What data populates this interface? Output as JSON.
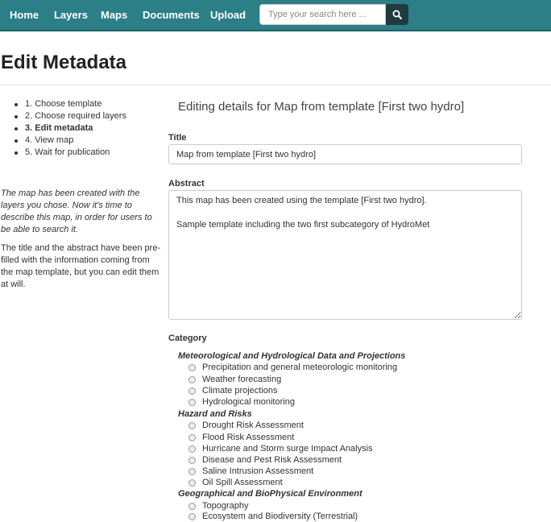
{
  "navbar": {
    "items": [
      "Home",
      "Layers",
      "Maps",
      "Documents",
      "Upload"
    ],
    "search_placeholder": "Type your search here ..."
  },
  "page": {
    "title": "Edit Metadata"
  },
  "steps": [
    {
      "label": "1. Choose template",
      "active": false
    },
    {
      "label": "2. Choose required layers",
      "active": false
    },
    {
      "label": "3. Edit metadata",
      "active": true
    },
    {
      "label": "4. View map",
      "active": false
    },
    {
      "label": "5. Wait for publication",
      "active": false
    }
  ],
  "sidebar": {
    "intro": "The map has been created with the layers you chose. Now it's time to describe this map, in order for users to be able to search it.",
    "note": "The title and the abstract have been pre-filled with the information coming from the map template, but you can edit them at will."
  },
  "form": {
    "heading": "Editing details for Map from template [First two hydro]",
    "title_label": "Title",
    "title_value": "Map from template [First two hydro]",
    "abstract_label": "Abstract",
    "abstract_value": "This map has been created using the template [First two hydro].\n\nSample template including the two first subcategory of HydroMet",
    "category_label": "Category"
  },
  "categories": [
    {
      "group": "Meteorological and Hydrological Data and Projections",
      "options": [
        "Precipitation and general meteorologic monitoring",
        "Weather forecasting",
        "Climate projections",
        "Hydrological monitoring"
      ]
    },
    {
      "group": "Hazard and Risks",
      "options": [
        "Drought Risk Assessment",
        "Flood Risk Assessment",
        "Hurricane and Storm surge Impact Analysis",
        "Disease and Pest Risk Assessment",
        "Saline Intrusion Assessment",
        "Oil Spill Assessment"
      ]
    },
    {
      "group": "Geographical and BioPhysical Environment",
      "options": [
        "Topography",
        "Ecosystem and Biodiversity (Terrestrial)"
      ]
    }
  ]
}
